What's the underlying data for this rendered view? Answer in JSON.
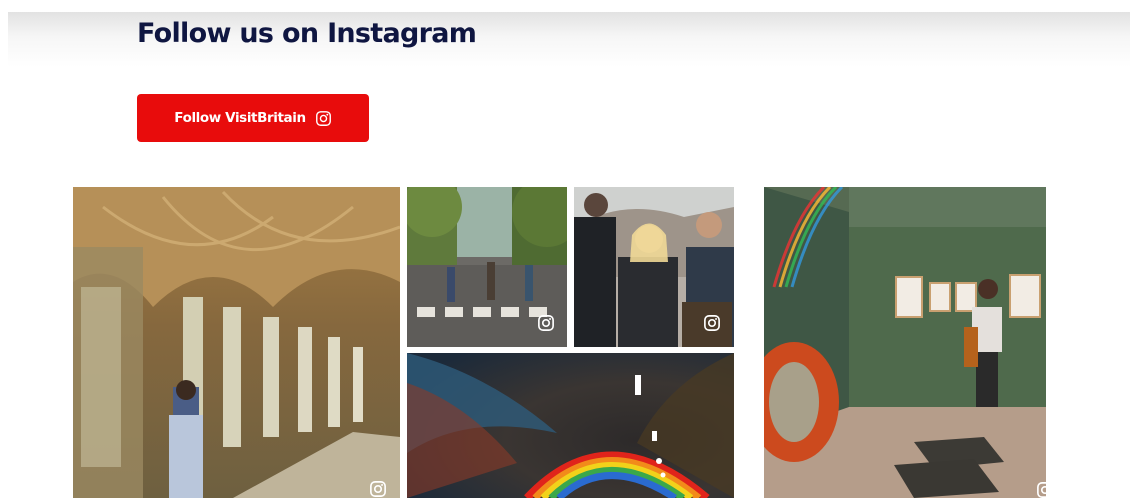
{
  "section": {
    "heading": "Follow us on Instagram",
    "follow_button": {
      "label": "Follow VisitBritain",
      "icon": "instagram-icon"
    }
  },
  "gallery": {
    "tiles": [
      {
        "name": "cloister-photo",
        "subject": "cloister",
        "badge_icon": "instagram-icon"
      },
      {
        "name": "crossing-photo",
        "subject": "zebra-crossing",
        "badge_icon": "instagram-icon"
      },
      {
        "name": "group-photo",
        "subject": "group-walk",
        "badge_icon": "instagram-icon"
      },
      {
        "name": "tunnel-photo",
        "subject": "rainbow-tunnel",
        "badge_icon": "instagram-icon"
      },
      {
        "name": "gallery-photo",
        "subject": "art-gallery",
        "badge_icon": "instagram-icon"
      }
    ]
  },
  "colors": {
    "heading": "#0f1641",
    "button_bg": "#e80c0c",
    "button_text": "#ffffff"
  }
}
